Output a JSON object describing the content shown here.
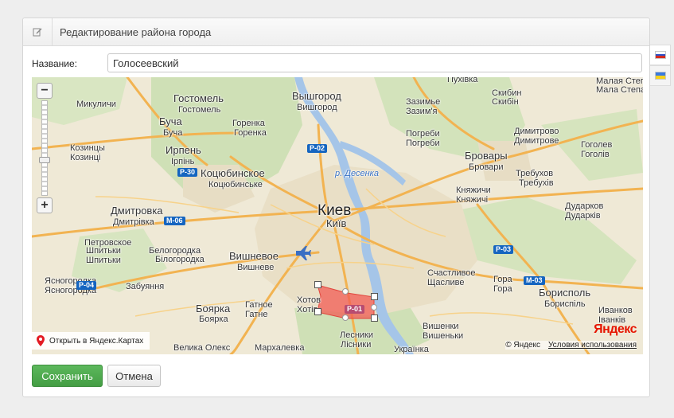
{
  "header": {
    "title": "Редактирование района города",
    "icon": "edit-icon"
  },
  "form": {
    "name_label": "Название:",
    "name_value": "Голосеевский"
  },
  "language_tabs": [
    {
      "name": "russian-flag-icon",
      "colors": [
        "#ffffff",
        "#2b4fc7",
        "#d52b1e"
      ],
      "active": true
    },
    {
      "name": "ukrainian-flag-icon",
      "colors": [
        "#3a7be0",
        "#f7d21a"
      ],
      "active": false
    }
  ],
  "map": {
    "zoom_in": "+",
    "zoom_out": "−",
    "open_link": "Открыть в Яндекс.Картах",
    "logo": "Яндекс",
    "copyright": "© Яндекс",
    "terms": "Условия использования",
    "highlight_color": "#f25c54",
    "labels": {
      "pukhivka": "Пухівка",
      "malaya_stepanovka": "Малая Степа",
      "mala_stepanivka": "Мала Степа",
      "skybin_ru": "Скибин",
      "skybin_ua": "Скибін",
      "mikulichi": "Микуличи",
      "gostomel": "Гостомель",
      "gostomel_ua": "Гостомель",
      "vyshgorod": "Вышгород",
      "vyshgorod_ua": "Вишгород",
      "zazimye": "Зазимье",
      "zazymia": "Зазим'я",
      "pogrebi_ru": "Погреби",
      "pogrebi_ua": "Погреби",
      "bucha": "Буча",
      "bucha_ua": "Буча",
      "gorenka": "Горенка",
      "gorenka_ua": "Горенка",
      "dimitrovo": "Димитрово",
      "dymytrove": "Димитрове",
      "kozintsy": "Козинцы",
      "kozyntsi": "Козинці",
      "irpen": "Ирпень",
      "irpin": "Ірпінь",
      "kotsubinskoe": "Коцюбинское",
      "kotsiubynske": "Коцюбинське",
      "desenka": "р. Десенка",
      "brovary": "Бровары",
      "brovary_ua": "Бровари",
      "goholev": "Гоголев",
      "hoholiv": "Гоголів",
      "trebukhov": "Требухов",
      "trebukhiv": "Требухів",
      "kniazhichi": "Княжичи",
      "kniazhychi": "Княжичі",
      "dmitrovka": "Дмитровка",
      "dmytrivka": "Дмитрівка",
      "kiev": "Киев",
      "kyiv": "Київ",
      "dudarkov": "Дударков",
      "dudarkiv": "Дударків",
      "petrovskoe": "Петровское",
      "shpitki": "Шпитьки",
      "shpytky": "Шпитьки",
      "belogorodka": "Белогородка",
      "bilohorodka": "Білогородка",
      "vishnevoe": "Вишневое",
      "vyshneve": "Вишневе",
      "shchaslivoe": "Счастливое",
      "shchaslyve": "Щасливе",
      "gora": "Гора",
      "gora_ua": "Гора",
      "yasnogorodka": "Ясногородка",
      "yasnohorodka": "Ясногородка",
      "zabuyannia": "Забуяння",
      "boryspil": "Борисполь",
      "boryspil_ua": "Бориспіль",
      "boyarka": "Боярка",
      "boiarka": "Боярка",
      "gatnoe": "Гатное",
      "hatne": "Гатне",
      "khotov": "Хотов",
      "khotiv": "Хотів",
      "vishenki": "Вишенки",
      "vyshenky": "Вишеньки",
      "ivankov": "Иванков",
      "ivankiv": "Іванків",
      "lesniki": "Лесники",
      "lisnyky": "Лісники",
      "markhalevka": "Мархалевка",
      "velykaya_alexandrovka": "Велика Олекс",
      "ukrainka": "Українка"
    },
    "roads": {
      "p02": "P-02",
      "p30": "P-30",
      "m06": "M-06",
      "p04": "P-04",
      "p01": "P-01",
      "p03": "P-03",
      "m03": "M-03"
    }
  },
  "buttons": {
    "save": "Сохранить",
    "cancel": "Отмена"
  }
}
